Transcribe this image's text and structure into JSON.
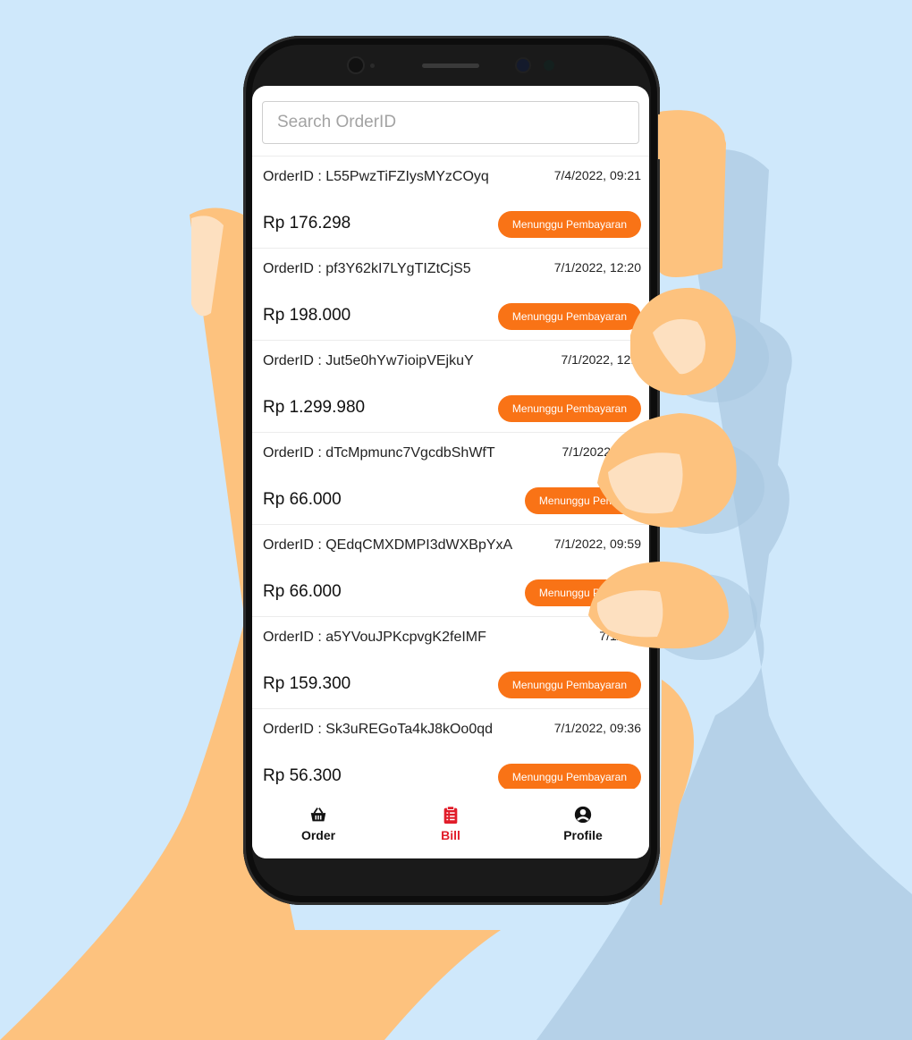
{
  "search": {
    "placeholder": "Search OrderID"
  },
  "orders": [
    {
      "id": "OrderID : L55PwzTiFZIysMYzCOyq",
      "date": "7/4/2022, 09:21",
      "amount": "Rp 176.298",
      "status": "Menunggu Pembayaran"
    },
    {
      "id": "OrderID : pf3Y62kI7LYgTIZtCjS5",
      "date": "7/1/2022, 12:20",
      "amount": "Rp 198.000",
      "status": "Menunggu Pembayaran"
    },
    {
      "id": "OrderID : Jut5e0hYw7ioipVEjkuY",
      "date": "7/1/2022, 12:2",
      "amount": "Rp 1.299.980",
      "status": "Menunggu Pembayaran"
    },
    {
      "id": "OrderID : dTcMpmunc7VgcdbShWfT",
      "date": "7/1/2022, 11:1",
      "amount": "Rp 66.000",
      "status": "Menunggu Pemba"
    },
    {
      "id": "OrderID : QEdqCMXDMPI3dWXBpYxA",
      "date": "7/1/2022, 09:59",
      "amount": "Rp 66.000",
      "status": "Menunggu Pemba"
    },
    {
      "id": "OrderID : a5YVouJPKcpvgK2feIMF",
      "date": "7/1/202",
      "amount": "Rp 159.300",
      "status": "Menunggu Pembayaran"
    },
    {
      "id": "OrderID : Sk3uREGoTa4kJ8kOo0qd",
      "date": "7/1/2022, 09:36",
      "amount": "Rp 56.300",
      "status": "Menunggu Pembayaran"
    }
  ],
  "nav": {
    "items": [
      {
        "label": "Order",
        "icon": "basket-icon"
      },
      {
        "label": "Bill",
        "icon": "clipboard-list-icon",
        "active": true
      },
      {
        "label": "Profile",
        "icon": "user-circle-icon"
      }
    ]
  },
  "colors": {
    "accent": "#f97316",
    "active": "#e11d2a",
    "background": "#cfe8fb",
    "skin": "#fdc27e"
  }
}
